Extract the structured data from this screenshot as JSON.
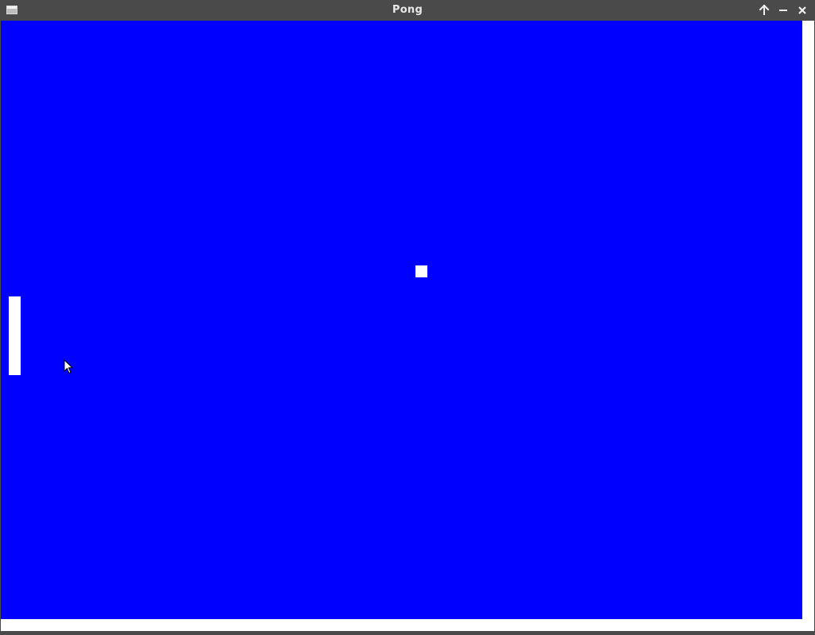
{
  "window": {
    "title": "Pong",
    "icon": "window-app-icon",
    "controls": [
      {
        "name": "maximize",
        "icon": "arrow-up-icon"
      },
      {
        "name": "minimize",
        "icon": "minus-icon"
      },
      {
        "name": "close",
        "icon": "close-icon"
      }
    ]
  },
  "game": {
    "court_color": "#0000ff",
    "paddle_color": "#ffffff",
    "ball_color": "#ffffff",
    "frame_color": "#ffffff",
    "titlebar_color": "#4a4a4a"
  }
}
